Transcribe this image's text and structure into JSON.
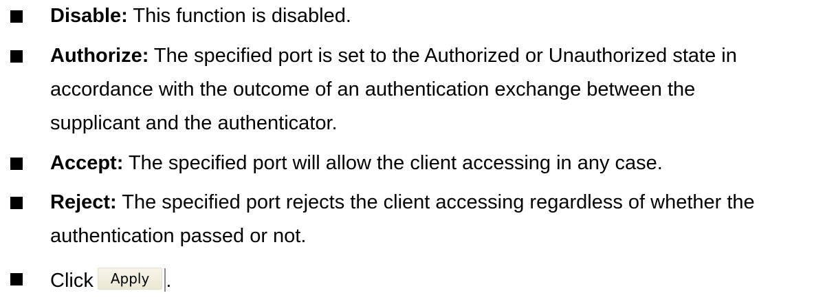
{
  "items": [
    {
      "term": "Disable:",
      "lines": [
        "This function is disabled."
      ]
    },
    {
      "term": "Authorize:",
      "lines": [
        "The specified port is set to the Authorized or Unauthorized state in",
        "accordance with the outcome of an authentication exchange between the",
        "supplicant and the authenticator."
      ]
    },
    {
      "term": "Accept:",
      "lines": [
        "The specified port will allow the client accessing in any case."
      ]
    },
    {
      "term": "Reject:",
      "lines": [
        "The specified port rejects the client accessing regardless of whether the",
        "authentication passed or not."
      ]
    }
  ],
  "instruction": {
    "text": "Click",
    "button_label": "Apply",
    "suffix": "."
  },
  "colors": {
    "text": "#000000",
    "bullet": "#000000",
    "button_bg": "#efedde"
  }
}
